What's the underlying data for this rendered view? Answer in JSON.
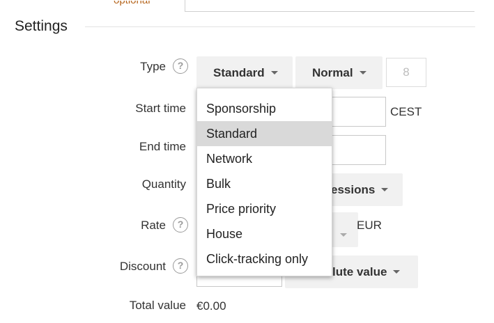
{
  "top": {
    "optional_label": "optional"
  },
  "section": {
    "title": "Settings"
  },
  "fields": {
    "type": {
      "label": "Type",
      "help": "?"
    },
    "start_time": {
      "label": "Start time",
      "timezone": "CEST"
    },
    "end_time": {
      "label": "End time"
    },
    "quantity": {
      "label": "Quantity",
      "unit_button": "essions"
    },
    "rate": {
      "label": "Rate",
      "help": "?",
      "currency": "EUR"
    },
    "discount": {
      "label": "Discount",
      "help": "?",
      "type_button": "lute value"
    },
    "total_value": {
      "label": "Total value",
      "value": "€0.00"
    }
  },
  "type_selector": {
    "selected": "Standard",
    "priority": "Normal",
    "priority_value": "8"
  },
  "type_menu": {
    "options": [
      "Sponsorship",
      "Standard",
      "Network",
      "Bulk",
      "Price priority",
      "House",
      "Click-tracking only"
    ],
    "selected_index": 1
  },
  "icons": {
    "help": "help-circle-icon",
    "caret": "caret-down-icon"
  }
}
